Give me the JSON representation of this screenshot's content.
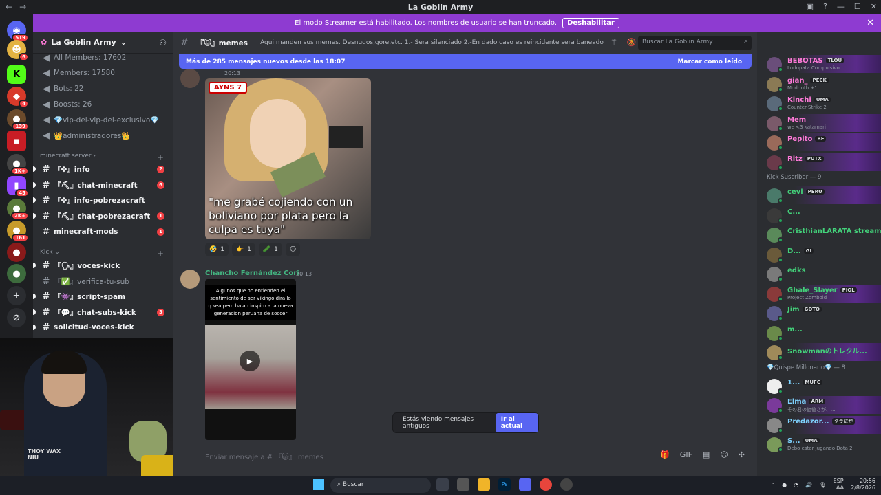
{
  "window": {
    "title": "La Goblin Army",
    "back": "←",
    "fwd": "→"
  },
  "streamer": {
    "text": "El modo Streamer está habilitado. Los nombres de usuario se han truncado.",
    "button": "Deshabilitar"
  },
  "rail": {
    "badges": [
      "519",
      "6",
      "4",
      "139",
      "1K+",
      "45",
      "2K+",
      "161"
    ]
  },
  "guild": {
    "name": "La Goblin Army"
  },
  "channels": {
    "top": [
      "All Members: 17602",
      "Members: 17580",
      "Bots: 22",
      "Boosts: 26",
      "💎vip-del-vip-del-exclusivo💎",
      "👑administradores👑"
    ],
    "cat1": "minecraft server",
    "mc": [
      {
        "name": "『✣』info",
        "count": "2"
      },
      {
        "name": "『⛏』chat-minecraft",
        "count": "6"
      },
      {
        "name": "『✣』info-pobrezacraft",
        "count": ""
      },
      {
        "name": "『⛏』chat-pobrezacraft",
        "count": "1"
      },
      {
        "name": "minecraft-mods",
        "count": "1"
      }
    ],
    "cat2": "Kick",
    "kick": [
      {
        "name": "『🗣』voces-kick",
        "count": ""
      },
      {
        "name": "『✅』verifica-tu-sub",
        "count": ""
      },
      {
        "name": "『👾』script-spam",
        "count": ""
      },
      {
        "name": "『💬』chat-subs-kick",
        "count": "3"
      },
      {
        "name": "solicitud-voces-kick",
        "count": ""
      }
    ]
  },
  "webcam": {
    "hoodie_text": "THOY WAX\nNIU"
  },
  "header": {
    "channel": "『🐱』memes",
    "topic": "Aqui manden sus memes. Desnudos,gore,etc. 1.- Sera silenciado 2.-En dado caso es reincidente sera baneado",
    "search_placeholder": "Buscar La Goblin Army"
  },
  "newbar": {
    "text": "Más de 285 mensajes nuevos desde las 18:07",
    "mark": "Marcar como leído"
  },
  "msg1": {
    "time": "20:13",
    "tag": "AYNS 7",
    "caption": "\"me grabé cojiendo con un boliviano por plata pero la culpa es tuya\"",
    "reacts": [
      {
        "emoji": "🤣",
        "count": "1"
      },
      {
        "emoji": "👉",
        "count": "1"
      },
      {
        "emoji": "🥒",
        "count": "1"
      }
    ]
  },
  "msg2": {
    "user": "Chancho Fernández Cori",
    "time": "20:13",
    "caption": "Algunos que no entienden el sentimiento de ser vikingo dira lo q sea pero halan inspiro a la nueva generacion peruana de soccer"
  },
  "oldbar": {
    "text": "Estás viendo mensajes antiguos",
    "button": "Ir al actual"
  },
  "composer": {
    "placeholder": "Enviar mensaje a # 『🐱』 memes"
  },
  "members": {
    "list1": [
      {
        "name": "BEBOTAS",
        "tag": "TLOU",
        "sub": "Ludopata Compulsivo",
        "color": "#ff7ad9"
      },
      {
        "name": "gian_",
        "tag": "PECK",
        "sub": "Modrinth +1",
        "color": "#ff7ad9"
      },
      {
        "name": "Kinchi",
        "tag": "UMA",
        "sub": "Counter-Strike 2",
        "color": "#ff7ad9"
      },
      {
        "name": "Mem",
        "tag": "",
        "sub": "we <3 katamari",
        "color": "#ff7ad9"
      },
      {
        "name": "Pepito",
        "tag": "BF",
        "sub": "",
        "color": "#ff7ad9"
      },
      {
        "name": "Ritz",
        "tag": "PUTX",
        "sub": "",
        "color": "#ff7ad9"
      }
    ],
    "cat2": "Kick Suscriber — 9",
    "list2": [
      {
        "name": "cevi",
        "tag": "PERU",
        "sub": "",
        "color": "#43d17a"
      },
      {
        "name": "C...",
        "tag": "",
        "sub": "",
        "color": "#43d17a"
      },
      {
        "name": "CristhianLARATA stream...",
        "tag": "",
        "sub": "",
        "color": "#43d17a"
      },
      {
        "name": "D...",
        "tag": "GI",
        "sub": "",
        "color": "#43d17a"
      },
      {
        "name": "edks",
        "tag": "",
        "sub": "",
        "color": "#43d17a"
      },
      {
        "name": "Ghale_Slayer",
        "tag": "PIOL",
        "sub": "Project Zomboid",
        "color": "#43d17a"
      },
      {
        "name": "Jim",
        "tag": "GOTO",
        "sub": "",
        "color": "#43d17a"
      },
      {
        "name": "m...",
        "tag": "",
        "sub": "",
        "color": "#43d17a"
      },
      {
        "name": "Snowmanのトレクル...",
        "tag": "",
        "sub": "",
        "color": "#43d17a"
      }
    ],
    "cat3": "💎Quispe Millonario💎 — 8",
    "list3": [
      {
        "name": "1...",
        "tag": "MUFC",
        "sub": "",
        "color": "#7fd3ff"
      },
      {
        "name": "Elma",
        "tag": "ARM",
        "sub": "その君の価値さが、...",
        "color": "#7fd3ff"
      },
      {
        "name": "Predazor...",
        "tag": "クラにが",
        "sub": "",
        "color": "#7fd3ff"
      },
      {
        "name": "S...",
        "tag": "UMA",
        "sub": "Debo estar jugando Dota 2",
        "color": "#7fd3ff"
      }
    ]
  },
  "taskbar": {
    "search": "Buscar",
    "lang": "ESP\nLAA",
    "time": "20:56",
    "date": "2/8/2026"
  }
}
